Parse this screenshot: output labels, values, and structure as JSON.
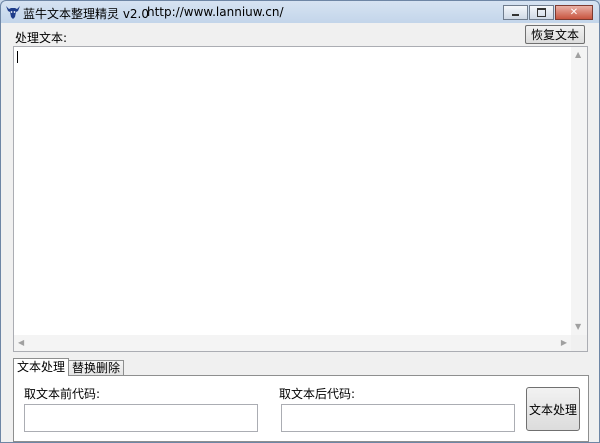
{
  "window": {
    "title": "蓝牛文本整理精灵 v2.0",
    "url": "http://www.lanniuw.cn/",
    "controls": {
      "close_glyph": "✕"
    },
    "icons": {
      "app": "bull-logo-icon",
      "minimize": "minimize-icon",
      "maximize": "maximize-icon",
      "close": "close-icon"
    }
  },
  "editor": {
    "label": "处理文本:",
    "restore_button": "恢复文本",
    "content": "",
    "scroll_arrows": {
      "up": "▲",
      "down": "▼",
      "left": "◀",
      "right": "▶"
    }
  },
  "tabs": [
    {
      "label": "文本处理",
      "active": true
    },
    {
      "label": "替换删除",
      "active": false
    }
  ],
  "panel": {
    "prefix_label": "取文本前代码:",
    "prefix_value": "",
    "suffix_label": "取文本后代码:",
    "suffix_value": "",
    "process_button": "文本处理"
  },
  "colors": {
    "titlebar": "#c3d5ea",
    "close": "#c8543f",
    "logo": "#1f3d8a"
  }
}
